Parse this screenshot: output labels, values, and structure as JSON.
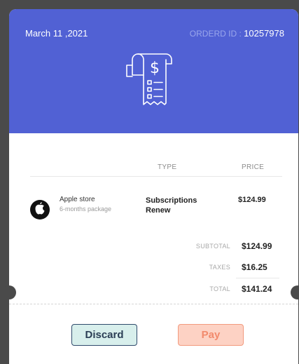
{
  "header": {
    "date": "March 11 ,2021",
    "order_label": "ORDERD ID :",
    "order_id": "10257978"
  },
  "table": {
    "col_type": "TYPE",
    "col_price": "PRICE"
  },
  "item": {
    "merchant": "Apple store",
    "package": "6-months package",
    "type_line1": "Subscriptions",
    "type_line2": "Renew",
    "price": "$124.99"
  },
  "summary": {
    "subtotal_label": "SUBTOTAL",
    "subtotal": "$124.99",
    "taxes_label": "TAXES",
    "taxes": "$16.25",
    "total_label": "TOTAL",
    "total": "$141.24"
  },
  "actions": {
    "discard": "Discard",
    "pay": "Pay"
  },
  "colors": {
    "header_bg": "#5161d4",
    "discard_bg": "#d8efec",
    "pay_bg": "#fdd2c4"
  },
  "icons": [
    "receipt-icon",
    "apple-logo-icon"
  ]
}
